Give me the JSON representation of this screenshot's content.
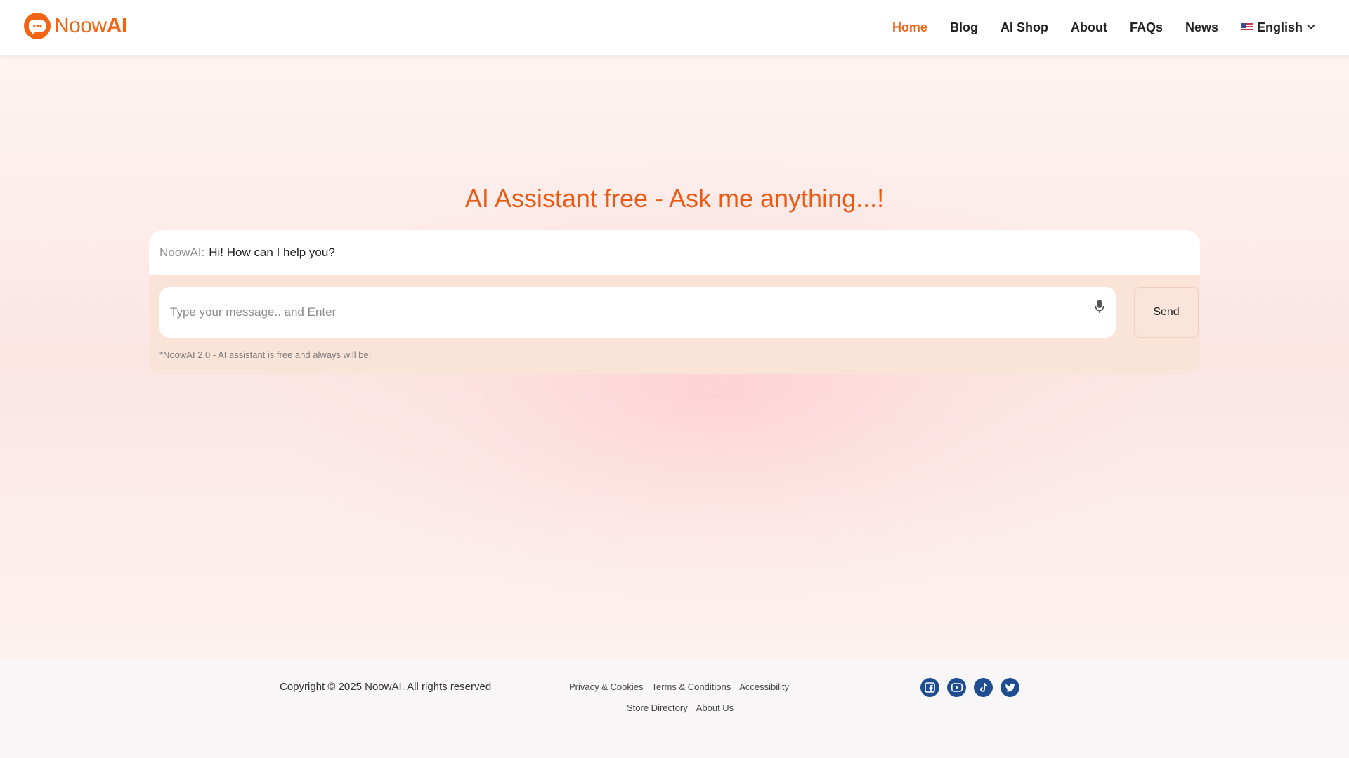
{
  "header": {
    "logo_text_light": "Noow",
    "logo_text_bold": "AI",
    "nav": {
      "home": "Home",
      "blog": "Blog",
      "ai_shop": "AI Shop",
      "about": "About",
      "faqs": "FAQs",
      "news": "News"
    },
    "language": "English"
  },
  "main": {
    "title": "AI Assistant free - Ask me anything...!",
    "chat": {
      "sender": "NoowAI:",
      "message": "Hi! How can I help you?"
    },
    "input": {
      "value": "",
      "placeholder": "Type your message.. and Enter"
    },
    "send_label": "Send",
    "note": "*NoowAI 2.0 - AI assistant is free and always will be!"
  },
  "footer": {
    "copyright": "Copyright © 2025 NoowAI. All rights reserved",
    "links_row1": [
      "Privacy & Cookies",
      "Terms & Conditions",
      "Accessibility"
    ],
    "links_row2": [
      "Store Directory",
      "About Us"
    ],
    "social_icons": [
      "facebook-icon",
      "youtube-icon",
      "tiktok-icon",
      "twitter-icon"
    ]
  },
  "colors": {
    "brand_orange": "#f06414",
    "social_blue": "#1e4e91"
  }
}
